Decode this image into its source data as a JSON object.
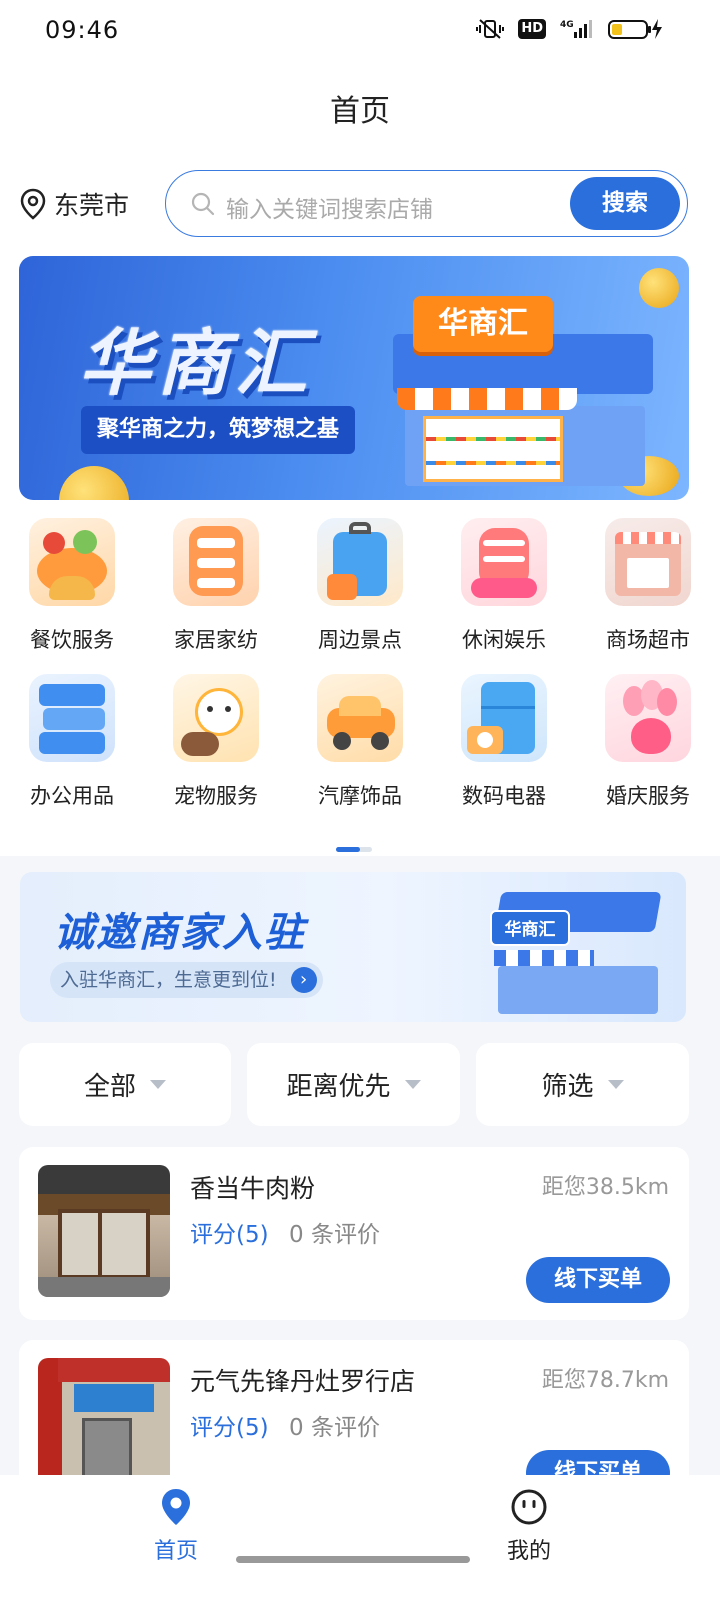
{
  "status_bar": {
    "time": "09:46",
    "network": "4G",
    "hd": "HD"
  },
  "header": {
    "title": "首页"
  },
  "location": {
    "city": "东莞市"
  },
  "search": {
    "placeholder": "输入关键词搜索店铺",
    "button_label": "搜索"
  },
  "hero_banner": {
    "brand": "华商汇",
    "slogan": "聚华商之力，筑梦想之基",
    "store_sign": "华商汇"
  },
  "categories": [
    {
      "label": "餐饮服务",
      "icon": "food-icon",
      "color": "#ffb36b"
    },
    {
      "label": "家居家纺",
      "icon": "home-textile-icon",
      "color": "#ffa86a"
    },
    {
      "label": "周边景点",
      "icon": "suitcase-icon",
      "color": "#5fb0f2"
    },
    {
      "label": "休闲娱乐",
      "icon": "leisure-icon",
      "color": "#ff8f8f"
    },
    {
      "label": "商场超市",
      "icon": "mall-icon",
      "color": "#f4c9c2"
    },
    {
      "label": "办公用品",
      "icon": "office-icon",
      "color": "#6aa8f0"
    },
    {
      "label": "宠物服务",
      "icon": "pet-icon",
      "color": "#ffd06a"
    },
    {
      "label": "汽摩饰品",
      "icon": "car-icon",
      "color": "#ffbf6a"
    },
    {
      "label": "数码电器",
      "icon": "appliance-icon",
      "color": "#62b2f2"
    },
    {
      "label": "婚庆服务",
      "icon": "wedding-icon",
      "color": "#ff9fb0"
    }
  ],
  "recruit_banner": {
    "title": "诚邀商家入驻",
    "subtitle": "入驻华商汇，生意更到位!",
    "store_sign": "华商汇"
  },
  "filters": [
    {
      "label": "全部"
    },
    {
      "label": "距离优先"
    },
    {
      "label": "筛选"
    }
  ],
  "stores": [
    {
      "name": "香当牛肉粉",
      "rating": "评分(5)",
      "reviews": "0 条评价",
      "distance": "距您38.5km",
      "button": "线下买单"
    },
    {
      "name": "元气先锋丹灶罗行店",
      "rating": "评分(5)",
      "reviews": "0 条评价",
      "distance": "距您78.7km",
      "button": "线下买单"
    }
  ],
  "bottom_nav": [
    {
      "label": "首页",
      "active": true
    },
    {
      "label": "我的",
      "active": false
    }
  ],
  "colors": {
    "primary": "#2a6fdc",
    "background_grey": "#f4f6f9"
  }
}
